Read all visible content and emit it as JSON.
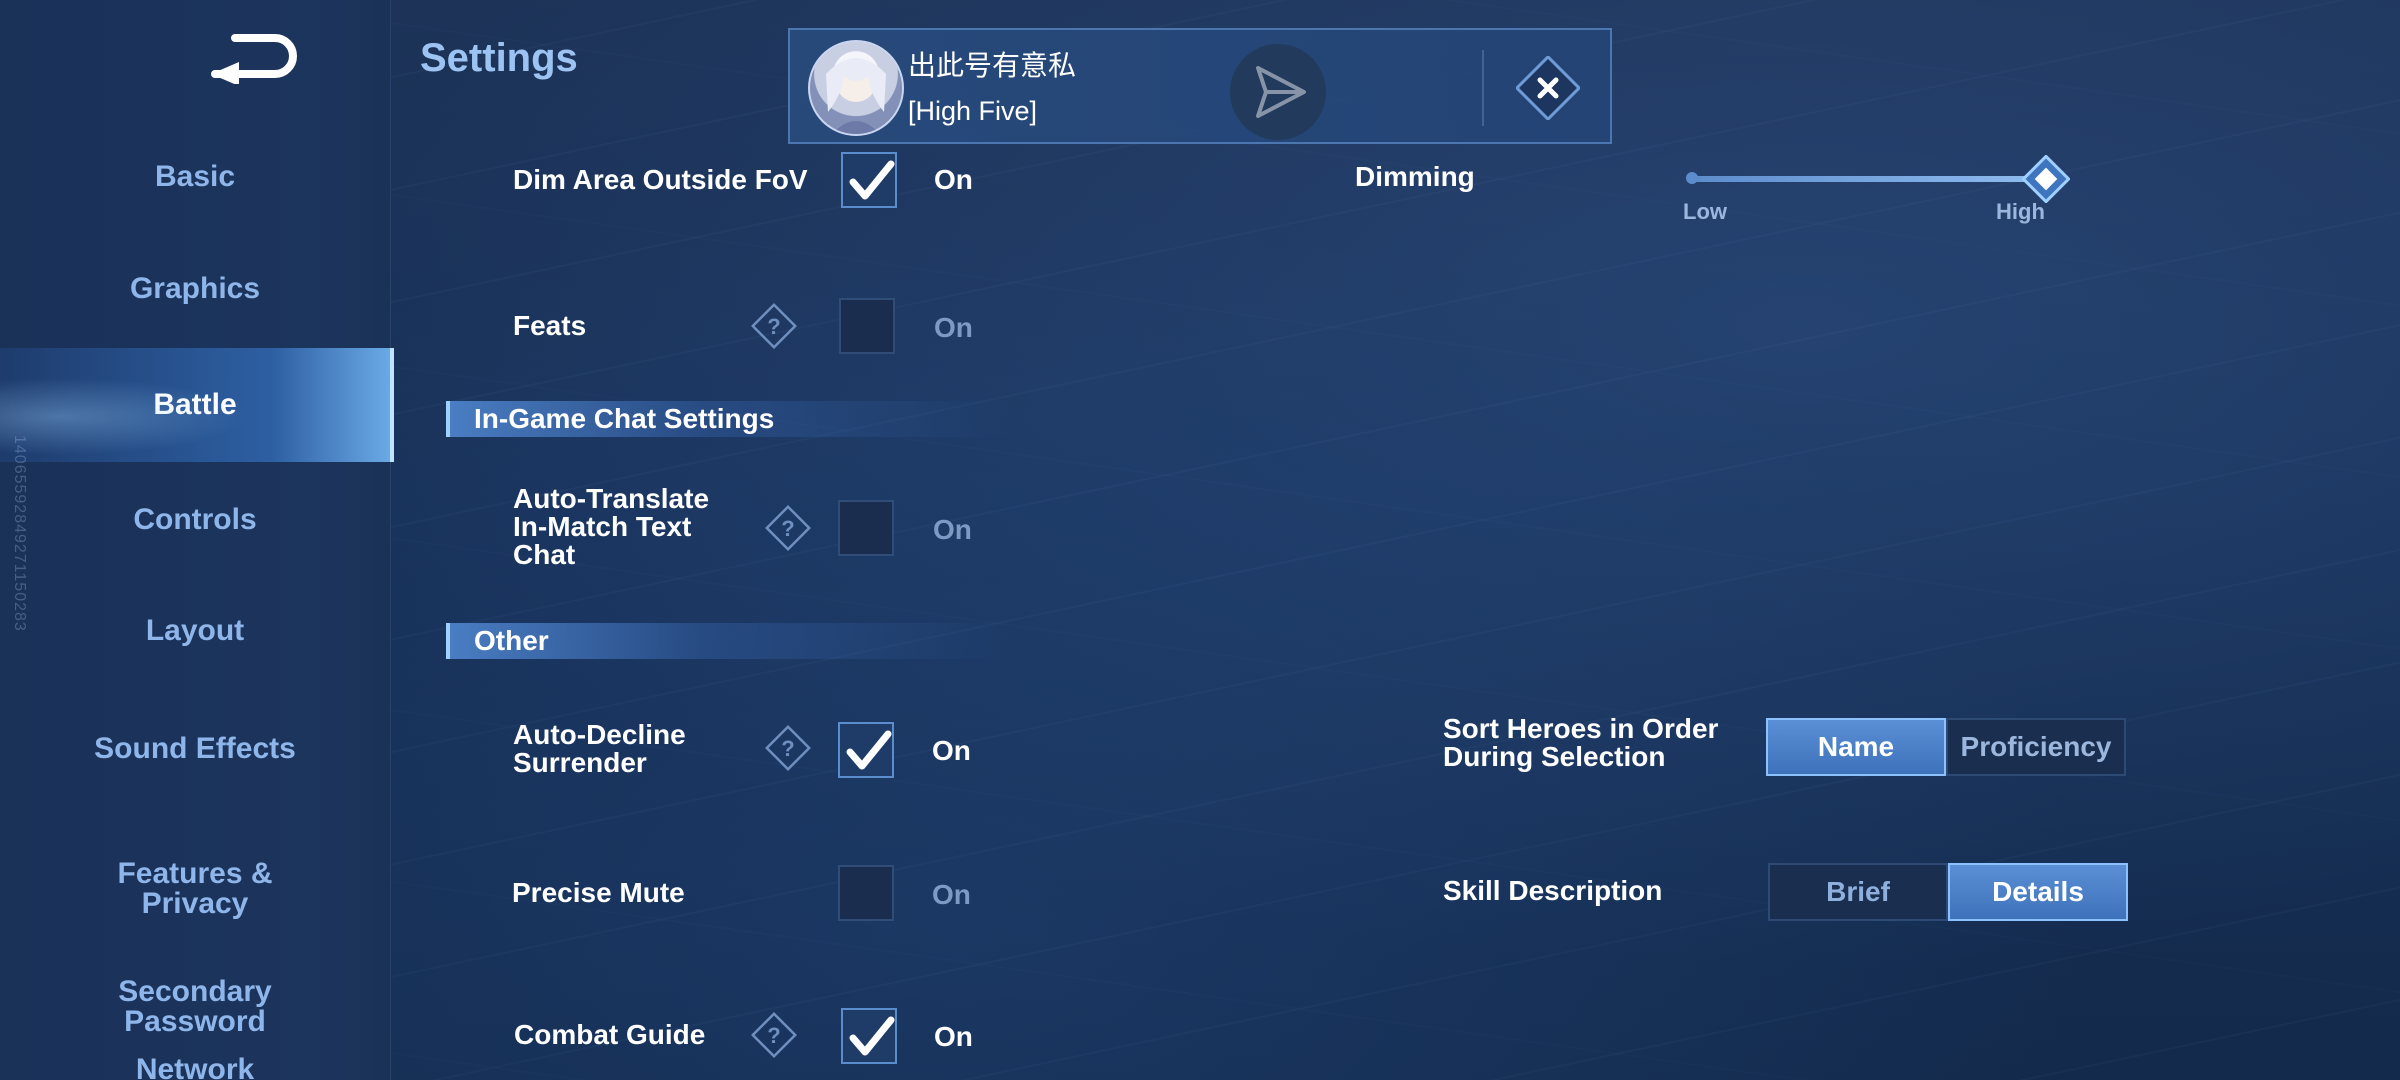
{
  "sidebar": {
    "items": [
      {
        "label": "Basic"
      },
      {
        "label": "Graphics"
      },
      {
        "label": "Battle"
      },
      {
        "label": "Controls"
      },
      {
        "label": "Layout"
      },
      {
        "label": "Sound Effects"
      },
      {
        "label": "Features &\nPrivacy"
      },
      {
        "label": "Secondary\nPassword"
      },
      {
        "label": "Network"
      }
    ],
    "active": "Battle",
    "side_id": "14065592849271150283"
  },
  "header": {
    "title": "Settings"
  },
  "notification": {
    "name": "出此号有意私",
    "message": "[High Five]"
  },
  "rows": {
    "dim_area": {
      "label": "Dim Area Outside FoV",
      "checked": true,
      "state": "On"
    },
    "feats": {
      "label": "Feats",
      "checked": false,
      "state": "On"
    },
    "auto_translate": {
      "label": "Auto-Translate\nIn-Match Text\nChat",
      "checked": false,
      "state": "On"
    },
    "auto_decline": {
      "label": "Auto-Decline\nSurrender",
      "checked": true,
      "state": "On"
    },
    "precise_mute": {
      "label": "Precise Mute",
      "checked": false,
      "state": "On"
    },
    "combat_guide": {
      "label": "Combat Guide",
      "checked": true,
      "state": "On"
    }
  },
  "sections": {
    "chat": "In-Game Chat Settings",
    "other": "Other"
  },
  "dimming": {
    "label": "Dimming",
    "low": "Low",
    "high": "High",
    "level": 1.0
  },
  "sort_heroes": {
    "label": "Sort Heroes in Order\nDuring Selection",
    "options": [
      "Name",
      "Proficiency"
    ],
    "selected": "Name"
  },
  "skill_description": {
    "label": "Skill Description",
    "options": [
      "Brief",
      "Details"
    ],
    "selected": "Details"
  },
  "colors": {
    "accent": "#5a8fd6",
    "nav_text": "#8fb6ea",
    "active_nav": "#ffffff"
  }
}
